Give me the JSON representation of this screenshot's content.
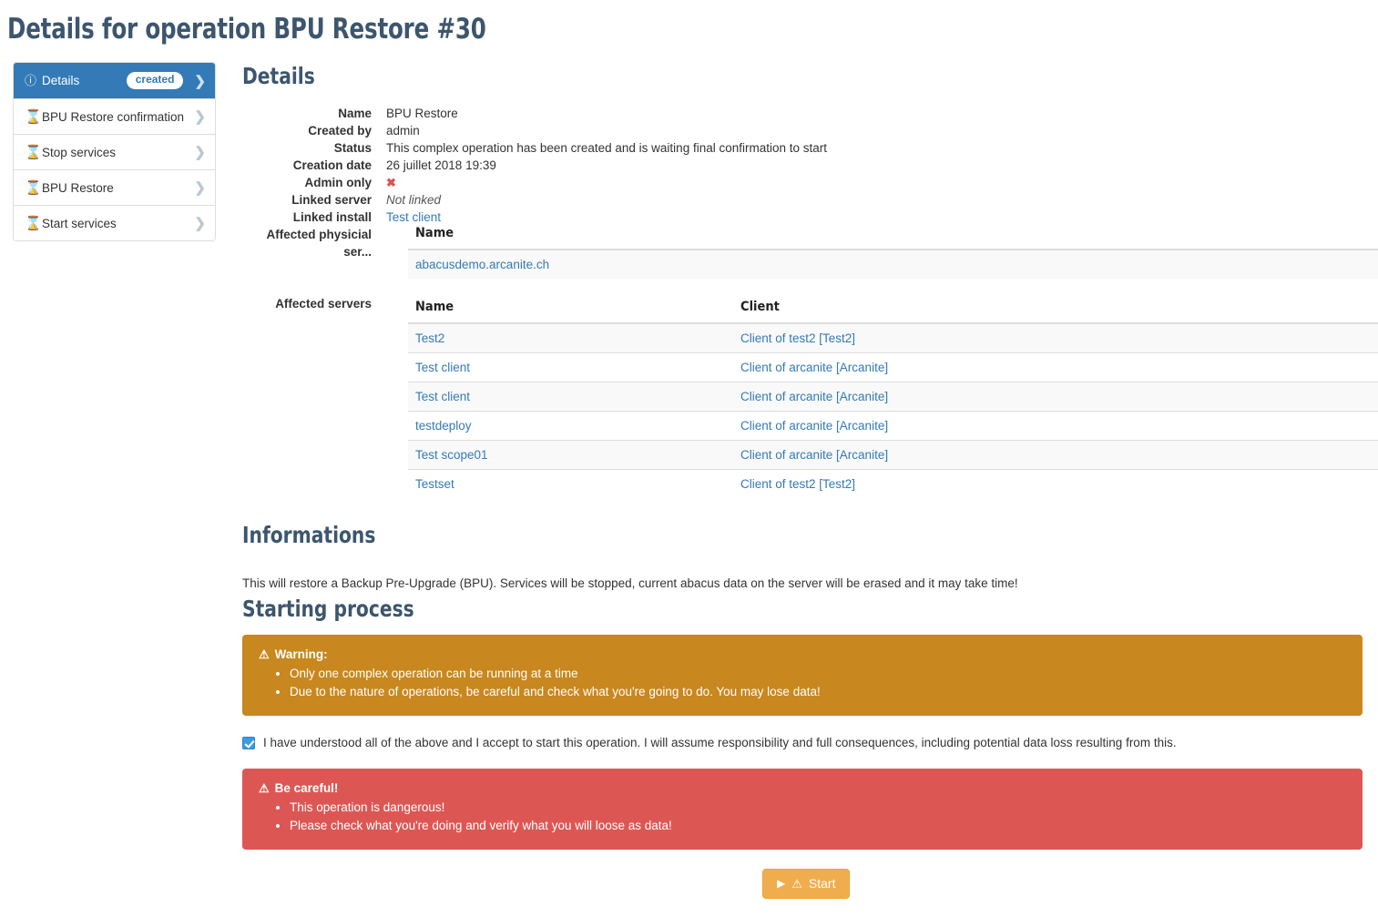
{
  "page": {
    "title": "Details for operation BPU Restore #30"
  },
  "sidebar": {
    "items": [
      {
        "label": "Details",
        "icon": "info-icon",
        "badge": "created",
        "active": true
      },
      {
        "label": "BPU Restore confirmation",
        "icon": "hourglass-icon",
        "badge": "",
        "active": false
      },
      {
        "label": "Stop services",
        "icon": "hourglass-icon",
        "badge": "",
        "active": false
      },
      {
        "label": "BPU Restore",
        "icon": "hourglass-icon",
        "badge": "",
        "active": false
      },
      {
        "label": "Start services",
        "icon": "hourglass-icon",
        "badge": "",
        "active": false
      }
    ],
    "chevron": "❯"
  },
  "details": {
    "heading": "Details",
    "fields": [
      {
        "term": "Name",
        "value": "BPU Restore"
      },
      {
        "term": "Created by",
        "value": "admin"
      },
      {
        "term": "Status",
        "value": "This complex operation has been created and is waiting final confirmation to start"
      },
      {
        "term": "Creation date",
        "value": "26 juillet 2018 19:39"
      },
      {
        "term": "Admin only",
        "value": "✖"
      },
      {
        "term": "Linked server",
        "value": "Not linked"
      },
      {
        "term": "Linked install",
        "value": "Test client"
      }
    ],
    "physical_servers": {
      "term": "Affected physicial ser...",
      "columns": [
        "Name"
      ],
      "rows": [
        [
          "abacusdemo.arcanite.ch"
        ]
      ]
    },
    "affected_servers": {
      "term": "Affected servers",
      "columns": [
        "Name",
        "Client"
      ],
      "rows": [
        [
          "Test2",
          "Client of test2 [Test2]"
        ],
        [
          "Test client",
          "Client of arcanite [Arcanite]"
        ],
        [
          "Test client",
          "Client of arcanite [Arcanite]"
        ],
        [
          "testdeploy",
          "Client of arcanite [Arcanite]"
        ],
        [
          "Test scope01",
          "Client of arcanite [Arcanite]"
        ],
        [
          "Testset",
          "Client of test2 [Test2]"
        ]
      ]
    }
  },
  "informations": {
    "heading": "Informations",
    "text": "This will restore a Backup Pre-Upgrade (BPU). Services will be stopped, current abacus data on the server will be erased and it may take time!"
  },
  "starting_process": {
    "heading": "Starting process",
    "warning": {
      "icon": "warning-triangle-icon",
      "title": "Warning:",
      "items": [
        "Only one complex operation can be running at a time",
        "Due to the nature of operations, be careful and check what you're going to do. You may lose data!"
      ],
      "color": "#c8871f"
    },
    "consent": {
      "checked": true,
      "label": "I have understood all of the above and I accept to start this operation. I will assume responsibility and full consequences, including potential data loss resulting from this."
    },
    "danger": {
      "icon": "warning-triangle-icon",
      "title": "Be careful!",
      "items": [
        "This operation is dangerous!",
        "Please check what you're doing and verify what you will loose as data!"
      ],
      "color": "#dc5754"
    },
    "start_button": {
      "label": "Start",
      "play_icon": "▶",
      "warn_icon": "⚠",
      "color": "#f0ad4e"
    }
  }
}
